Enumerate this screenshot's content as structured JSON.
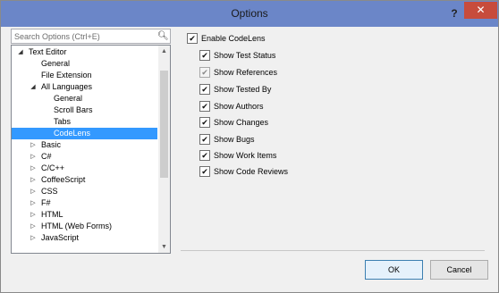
{
  "window": {
    "title": "Options",
    "help_label": "?",
    "close_label": "✕"
  },
  "search": {
    "placeholder": "Search Options (Ctrl+E)",
    "icon": "search-icon"
  },
  "tree": {
    "items": [
      {
        "label": "Text Editor",
        "expanded": true,
        "selected": false
      },
      {
        "label": "General",
        "selected": false
      },
      {
        "label": "File Extension",
        "selected": false
      },
      {
        "label": "All Languages",
        "expanded": true,
        "selected": false
      },
      {
        "label": "General",
        "selected": false
      },
      {
        "label": "Scroll Bars",
        "selected": false
      },
      {
        "label": "Tabs",
        "selected": false
      },
      {
        "label": "CodeLens",
        "selected": true
      },
      {
        "label": "Basic",
        "expanded": false,
        "selected": false
      },
      {
        "label": "C#",
        "expanded": false,
        "selected": false
      },
      {
        "label": "C/C++",
        "expanded": false,
        "selected": false
      },
      {
        "label": "CoffeeScript",
        "expanded": false,
        "selected": false
      },
      {
        "label": "CSS",
        "expanded": false,
        "selected": false
      },
      {
        "label": "F#",
        "expanded": false,
        "selected": false
      },
      {
        "label": "HTML",
        "expanded": false,
        "selected": false
      },
      {
        "label": "HTML (Web Forms)",
        "expanded": false,
        "selected": false
      },
      {
        "label": "JavaScript",
        "expanded": false,
        "selected": false
      }
    ]
  },
  "options": {
    "enable_codelens": {
      "label": "Enable CodeLens",
      "checked": true
    },
    "items": [
      {
        "label": "Show Test Status",
        "checked": true,
        "enabled": true
      },
      {
        "label": "Show References",
        "checked": true,
        "enabled": false
      },
      {
        "label": "Show Tested By",
        "checked": true,
        "enabled": true
      },
      {
        "label": "Show Authors",
        "checked": true,
        "enabled": true
      },
      {
        "label": "Show Changes",
        "checked": true,
        "enabled": true
      },
      {
        "label": "Show Bugs",
        "checked": true,
        "enabled": true
      },
      {
        "label": "Show Work Items",
        "checked": true,
        "enabled": true
      },
      {
        "label": "Show Code Reviews",
        "checked": true,
        "enabled": true
      }
    ]
  },
  "buttons": {
    "ok_label": "OK",
    "cancel_label": "Cancel"
  },
  "colors": {
    "titlebar": "#6b86c8",
    "selection": "#3399ff",
    "close": "#c74c3c"
  }
}
